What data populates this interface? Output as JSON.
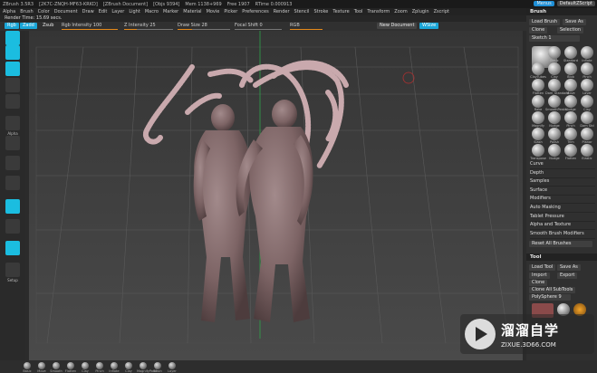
{
  "titlebar": {
    "segments": [
      "ZBrush 3.5R3",
      "[2K7C-ZNQH-MF63-KRKD]",
      "[ZBrush Document]",
      "[Objs 9394]",
      "Mem 1138+969",
      "Free 1907",
      "RTime 0.000913"
    ],
    "right_buttons": [
      "Menus",
      "DefaultZScript"
    ]
  },
  "menu": [
    "Alpha",
    "Brush",
    "Color",
    "Document",
    "Draw",
    "Edit",
    "Layer",
    "Light",
    "Macro",
    "Marker",
    "Material",
    "Movie",
    "Picker",
    "Preferences",
    "Render",
    "Stencil",
    "Stroke",
    "Texture",
    "Tool",
    "Transform",
    "Zoom",
    "Zplugin",
    "Zscript"
  ],
  "status": "Render Time: 15.69 secs.",
  "shelf": {
    "rgb_label": "Rgb",
    "zadd_label": "Zadd",
    "zsub_label": "Zsub",
    "rgb_intensity": {
      "label": "Rgb Intensity 100",
      "value": 100
    },
    "z_intensity": {
      "label": "Z Intensity 25",
      "value": 25
    },
    "draw_size": {
      "label": "Draw Size 28",
      "value": 28
    },
    "focal_shift": {
      "label": "Focal Shift 0",
      "value": 0
    },
    "rgb2": {
      "label": "RGB",
      "value": 100
    },
    "new_document": "New Document",
    "wsize": "WSize"
  },
  "left_tools": [
    {
      "name": "edit-tool",
      "label": "",
      "on": true
    },
    {
      "name": "draw-tool",
      "label": "",
      "on": true
    },
    {
      "name": "move-tool",
      "label": "",
      "on": true
    },
    {
      "name": "scale-tool",
      "label": "",
      "on": false
    },
    {
      "name": "rotate-tool",
      "label": "",
      "on": false
    },
    {
      "name": "alpha-tool",
      "label": "Alpha",
      "on": false
    },
    {
      "name": "stroke-tool",
      "label": "",
      "on": false
    },
    {
      "name": "texture-tool",
      "label": "",
      "on": false
    },
    {
      "name": "material-tool",
      "label": "",
      "on": false
    },
    {
      "name": "frame-tool",
      "label": "",
      "on": true
    },
    {
      "name": "grid-tool",
      "label": "",
      "on": false
    },
    {
      "name": "xyz-tool",
      "label": "",
      "on": true
    },
    {
      "name": "setup-tool",
      "label": "Setup",
      "on": false
    }
  ],
  "brush_panel": {
    "title": "Brush",
    "load": "Load Brush",
    "save": "Save As",
    "clone": "Clone",
    "selection": "Selection",
    "sketch": "Sketch 1",
    "brushes": [
      "",
      "Basic",
      "Standard",
      "Inflate",
      "ClayTubes",
      "Clay",
      "Blob",
      "Pinch",
      "Flatten",
      "Dam_Standard",
      "Move",
      "Layer",
      "Rake",
      "SmoothPeaks",
      "Nudge",
      "Clay",
      "Magnify",
      "Nudge",
      "Pinch",
      "Dam Std",
      "Slash",
      "Polish",
      "Trim",
      "Planar",
      "Transpose",
      "Nudge",
      "Flatten",
      "Elastic"
    ],
    "sections": [
      "Curve",
      "Depth",
      "Samples",
      "Surface",
      "Modifiers",
      "Auto Masking",
      "Tablet Pressure",
      "Alpha and Texture",
      "Smooth Brush Modifiers"
    ],
    "reset": "Reset All Brushes"
  },
  "tool_panel": {
    "title": "Tool",
    "load": "Load Tool",
    "save": "Save As",
    "import": "Import",
    "export": "Export",
    "clone": "Clone",
    "clone_all": "Clone All SubTools",
    "polysphere": "PolySphere 9",
    "subtool": "SubTool"
  },
  "bottom_materials": [
    "Basic",
    "Move",
    "Smooth",
    "Flatten",
    "Clay",
    "Pinch",
    "Inflate",
    "Clay",
    "MagnifyPoint",
    "Slash",
    "Layer"
  ],
  "watermark": {
    "cn": "溜溜自学",
    "url": "ZIXUE.3D66.COM"
  },
  "colors": {
    "accent": "#1aa6d8",
    "slider_fill": "#e58a1a",
    "viewport": "#3b3b3b",
    "floor_grid": "#5a5a5a",
    "model": "#8a6f70"
  }
}
